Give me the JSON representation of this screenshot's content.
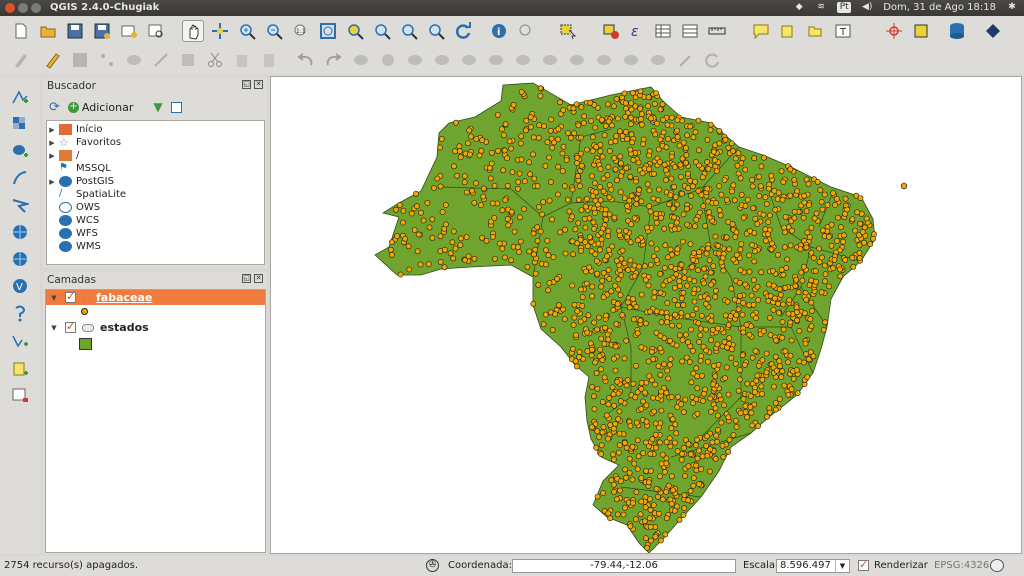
{
  "window": {
    "title": "QGIS 2.4.0-Chugiak"
  },
  "tray": {
    "lang": "Pt",
    "datetime": "Dom, 31 de Ago 18:18"
  },
  "toolbar_main": [
    "new-project",
    "open-project",
    "save-project",
    "save-as",
    "new-print-composer",
    "composer-manager",
    "pan",
    "pan-to-selection",
    "zoom-in",
    "zoom-out",
    "zoom-native",
    "zoom-full",
    "zoom-to-layer",
    "zoom-to-selection",
    "zoom-last",
    "zoom-next",
    "refresh",
    "identify",
    "map-tips",
    "select",
    "deselect",
    "calculator",
    "attribute-table",
    "open-field-calc",
    "measure",
    "annotation",
    "bookmark",
    "text-annotation",
    "gps",
    "plugin",
    "db-manager",
    "python"
  ],
  "browser": {
    "title": "Buscador",
    "add_label": "Adicionar",
    "items": [
      {
        "label": "Início",
        "icon": "home-folder-icon",
        "expandable": true
      },
      {
        "label": "Favoritos",
        "icon": "star-icon",
        "expandable": true
      },
      {
        "label": "/",
        "icon": "folder-icon",
        "expandable": true
      },
      {
        "label": "MSSQL",
        "icon": "mssql-icon",
        "expandable": false
      },
      {
        "label": "PostGIS",
        "icon": "postgis-icon",
        "expandable": true
      },
      {
        "label": "SpatiaLite",
        "icon": "spatialite-icon",
        "expandable": false
      },
      {
        "label": "OWS",
        "icon": "globe-icon",
        "expandable": false
      },
      {
        "label": "WCS",
        "icon": "wcs-icon",
        "expandable": false
      },
      {
        "label": "WFS",
        "icon": "wfs-icon",
        "expandable": false
      },
      {
        "label": "WMS",
        "icon": "wms-icon",
        "expandable": false
      }
    ]
  },
  "layers": {
    "title": "Camadas",
    "items": [
      {
        "name": "fabaceae",
        "checked": true,
        "selected": true,
        "symbol": "point",
        "color": "#f0a800"
      },
      {
        "name": "estados",
        "checked": true,
        "selected": false,
        "symbol": "polygon",
        "color": "#6fa52f"
      }
    ]
  },
  "status": {
    "message": "2754 recurso(s) apagados.",
    "coord_label": "Coordenada:",
    "coord_value": "-79.44,-12.06",
    "scale_label": "Escala",
    "scale_value": "8.596.497",
    "render_label": "Renderizar",
    "render_checked": true,
    "crs": "EPSG:4326"
  },
  "colors": {
    "selection": "#f07b3f",
    "polygon": "#6fa52f",
    "points": "#f0a800",
    "point_outline": "#1a1a1a"
  }
}
